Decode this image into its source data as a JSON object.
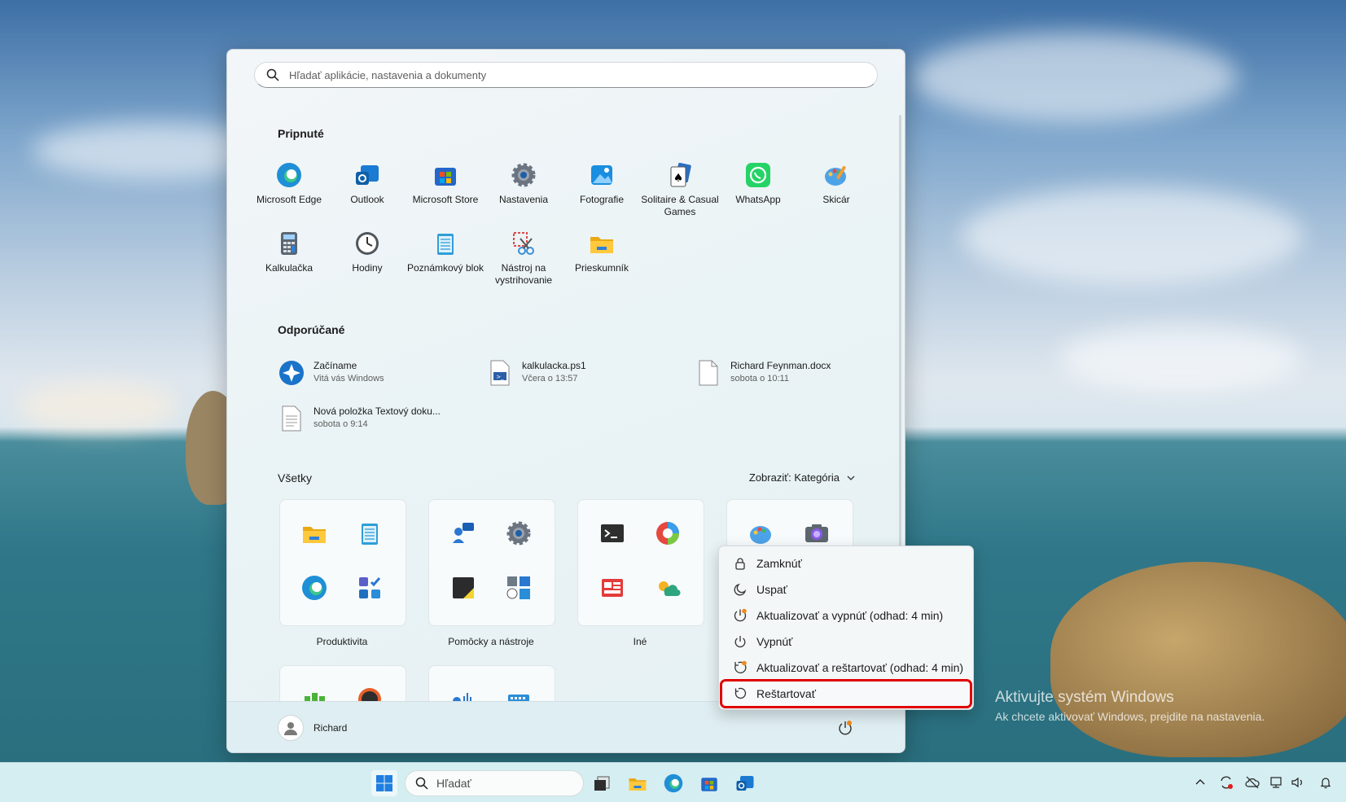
{
  "search": {
    "placeholder": "Hľadať aplikácie, nastavenia a dokumenty"
  },
  "pinned": {
    "title": "Pripnuté",
    "apps": [
      {
        "label": "Microsoft Edge",
        "icon": "edge-icon"
      },
      {
        "label": "Outlook",
        "icon": "outlook-icon"
      },
      {
        "label": "Microsoft Store",
        "icon": "store-icon"
      },
      {
        "label": "Nastavenia",
        "icon": "settings-icon"
      },
      {
        "label": "Fotografie",
        "icon": "photos-icon"
      },
      {
        "label": "Solitaire & Casual Games",
        "icon": "solitaire-icon"
      },
      {
        "label": "WhatsApp",
        "icon": "whatsapp-icon"
      },
      {
        "label": "Skicár",
        "icon": "paint-icon"
      },
      {
        "label": "Kalkulačka",
        "icon": "calculator-icon"
      },
      {
        "label": "Hodiny",
        "icon": "clock-icon"
      },
      {
        "label": "Poznámkový blok",
        "icon": "notepad-icon"
      },
      {
        "label": "Nástroj na vystrihovanie",
        "icon": "snipping-tool-icon"
      },
      {
        "label": "Prieskumník",
        "icon": "file-explorer-icon"
      }
    ]
  },
  "recommended": {
    "title": "Odporúčané",
    "items": [
      {
        "name": "Začíname",
        "sub": "Vitá vás Windows"
      },
      {
        "name": "kalkulacka.ps1",
        "sub": "Včera o 13:57"
      },
      {
        "name": "Richard Feynman.docx",
        "sub": "sobota o 10:11"
      },
      {
        "name": "Nová položka Textový doku...",
        "sub": "sobota o 9:14"
      }
    ]
  },
  "all": {
    "title": "Všetky",
    "view_label": "Zobraziť: Kategória",
    "folders": [
      {
        "label": "Produktivita"
      },
      {
        "label": "Pomôcky a nástroje"
      },
      {
        "label": "Iné"
      }
    ]
  },
  "user": {
    "name": "Richard"
  },
  "power_menu": {
    "items": [
      {
        "label": "Zamknúť",
        "icon": "lock-icon"
      },
      {
        "label": "Uspať",
        "icon": "sleep-icon"
      },
      {
        "label": "Aktualizovať a vypnúť (odhad: 4 min)",
        "icon": "update-shutdown-icon"
      },
      {
        "label": "Vypnúť",
        "icon": "power-icon"
      },
      {
        "label": "Aktualizovať a reštartovať (odhad: 4 min)",
        "icon": "update-restart-icon"
      },
      {
        "label": "Reštartovať",
        "icon": "restart-icon"
      }
    ],
    "highlighted": "Reštartovať",
    "highlight_color": "#e00000"
  },
  "watermark": {
    "line1": "Aktivujte systém Windows",
    "line2": "Ak chcete aktivovať Windows, prejdite na nastavenia."
  },
  "taskbar": {
    "search_label": "Hľadať",
    "apps": [
      "start-icon",
      "task-view-icon",
      "file-explorer-icon",
      "edge-icon",
      "store-icon",
      "outlook-icon"
    ]
  },
  "colors": {
    "accent": "#0067c0",
    "menu_background": "#eaf3f6",
    "taskbar": "#d5eef2"
  }
}
